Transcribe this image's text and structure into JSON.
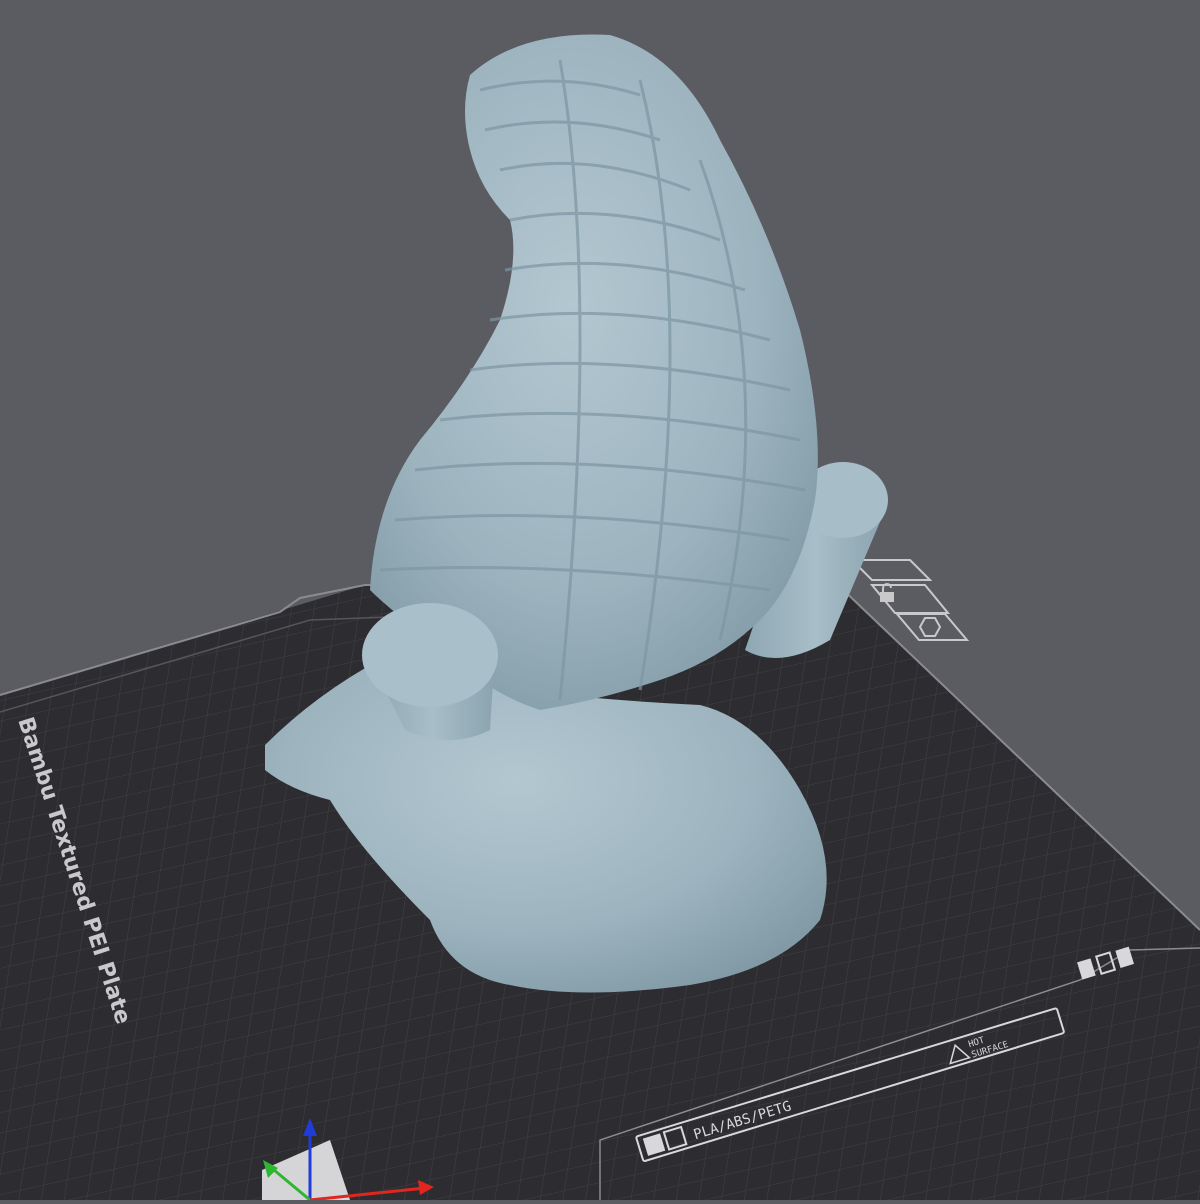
{
  "scene": {
    "background_color": "#5b5b62",
    "plate": {
      "name": "Bambu Textured PEI Plate",
      "surface_color": "#2e2e32",
      "grid_color": "#44444a",
      "label_strip": {
        "materials": "PLA/ABS/PETG",
        "warning_line1": "HOT",
        "warning_line2": "SURFACE"
      }
    },
    "model": {
      "color": "#9fb7c2",
      "shading_color": "#7f9aa7"
    },
    "plate_icons": [
      "plate-settings-icon",
      "lock-icon",
      "auto-orient-icon"
    ],
    "axes": {
      "x_color": "#e0261f",
      "y_color": "#2fb532",
      "z_color": "#1f3bd8"
    }
  }
}
